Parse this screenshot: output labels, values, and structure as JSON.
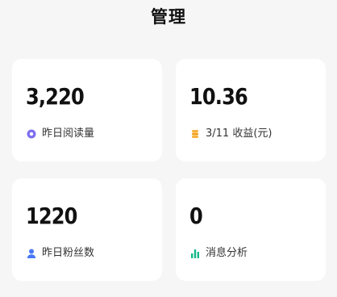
{
  "header": {
    "title": "管理"
  },
  "cards": [
    {
      "value": "3,220",
      "label": "昨日阅读量",
      "icon": "read-icon",
      "icon_color": "#6c5ce7"
    },
    {
      "value": "10.36",
      "label": "3/11 收益(元)",
      "icon": "coin-stack-icon",
      "icon_color": "#f5a623"
    },
    {
      "value": "1220",
      "label": "昨日粉丝数",
      "icon": "user-icon",
      "icon_color": "#4a78f5"
    },
    {
      "value": "0",
      "label": "消息分析",
      "icon": "bar-chart-icon",
      "icon_color": "#14b88a"
    }
  ]
}
